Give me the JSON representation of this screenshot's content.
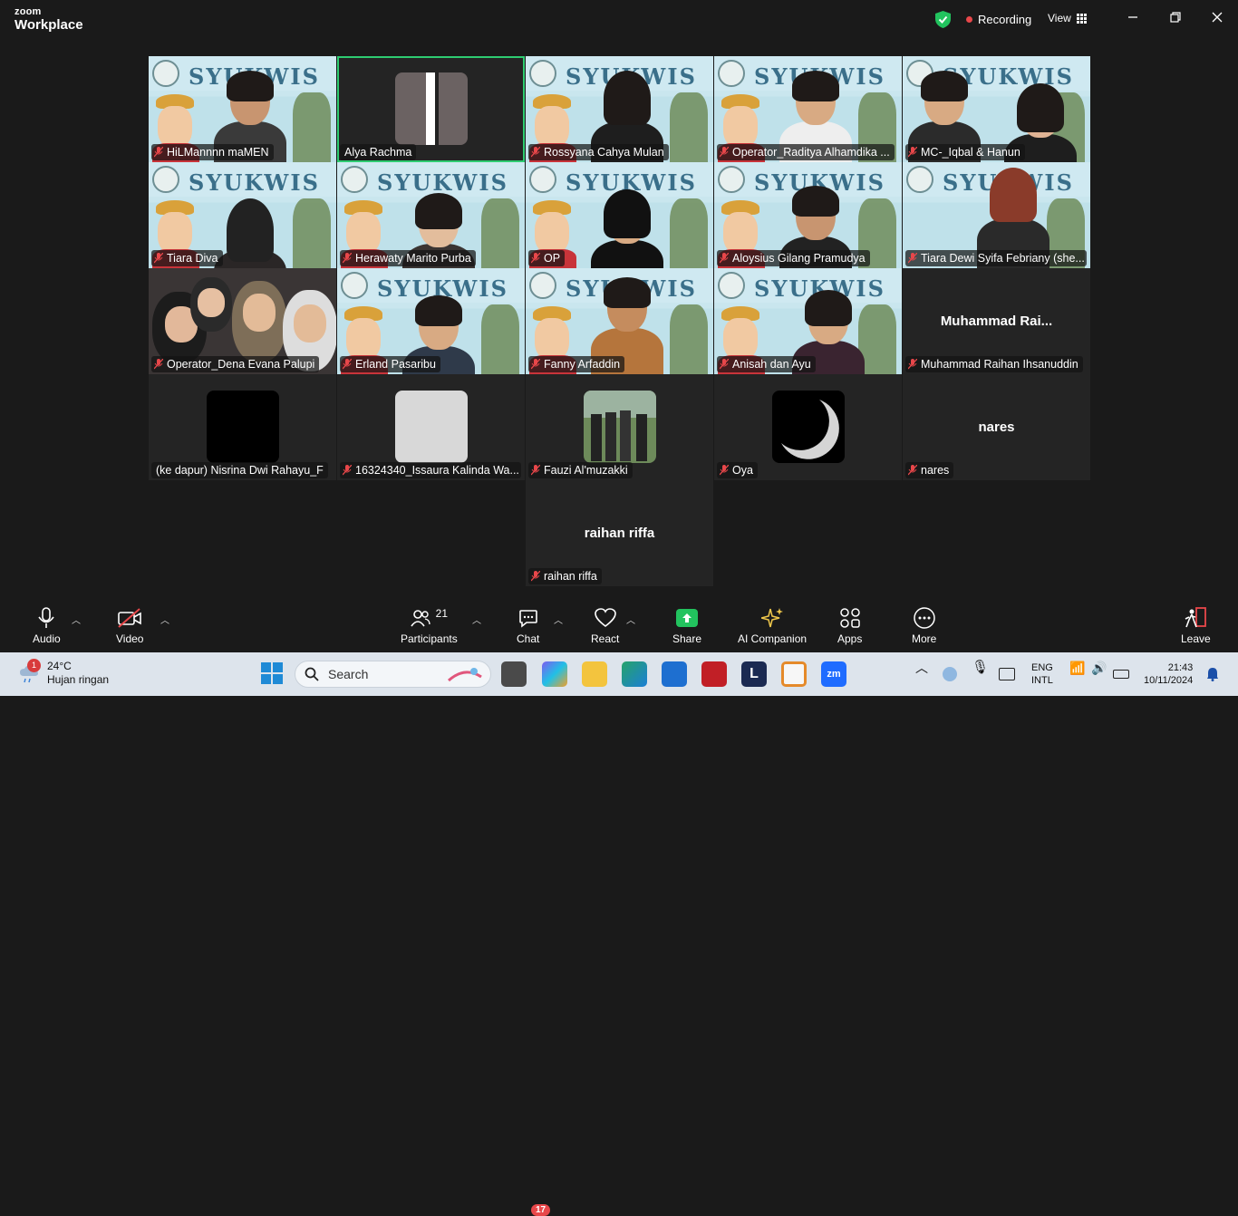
{
  "app": {
    "brand_line1": "zoom",
    "brand_line2": "Workplace"
  },
  "titlebar": {
    "recording_label": "Recording",
    "view_label": "View"
  },
  "participants": [
    {
      "name": "HiLMannnn maMEN"
    },
    {
      "name": "Alya Rachma"
    },
    {
      "name": "Rossyana Cahya Mulan"
    },
    {
      "name": "Operator_Raditya Alhamdika ..."
    },
    {
      "name": "MC-_Iqbal & Hanun"
    },
    {
      "name": "Tiara Diva"
    },
    {
      "name": "Herawaty Marito Purba"
    },
    {
      "name": "OP"
    },
    {
      "name": "Aloysius Gilang Pramudya"
    },
    {
      "name": "Tiara Dewi Syifa Febriany (she..."
    },
    {
      "name": "Operator_Dena Evana Palupi"
    },
    {
      "name": "Erland Pasaribu"
    },
    {
      "name": "Fanny Arfaddin"
    },
    {
      "name": "Anisah dan Ayu"
    },
    {
      "name": "Muhammad Raihan Ihsanuddin",
      "display_name": "Muhammad  Rai..."
    },
    {
      "name": "(ke dapur) Nisrina Dwi Rahayu_F"
    },
    {
      "name": "16324340_Issaura Kalinda Wa..."
    },
    {
      "name": "Fauzi Al'muzakki"
    },
    {
      "name": "Oya"
    },
    {
      "name": "nares",
      "display_name": "nares"
    },
    {
      "name": "raihan riffa",
      "display_name": "raihan riffa"
    }
  ],
  "banner_text": "SYUKWIS",
  "toolbar": {
    "audio": "Audio",
    "video": "Video",
    "participants": "Participants",
    "participants_count": "21",
    "chat": "Chat",
    "chat_badge": "17",
    "react": "React",
    "share": "Share",
    "ai_companion": "AI Companion",
    "apps": "Apps",
    "more": "More",
    "leave": "Leave"
  },
  "taskbar": {
    "weather_temp": "24°C",
    "weather_desc": "Hujan ringan",
    "weather_badge": "1",
    "search_placeholder": "Search",
    "lang_line1": "ENG",
    "lang_line2": "INTL",
    "time": "21:43",
    "date": "10/11/2024"
  },
  "colors": {
    "active_speaker": "#2ecc71",
    "recording": "#e8474a",
    "share": "#22c35e",
    "background": "#1a1a1a"
  }
}
